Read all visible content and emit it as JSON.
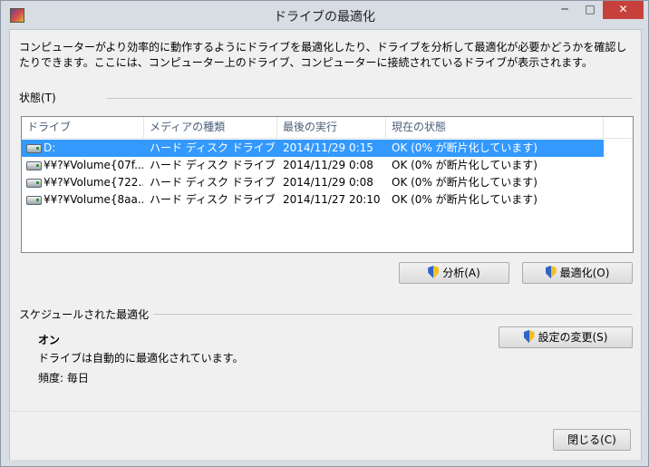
{
  "window": {
    "title": "ドライブの最適化",
    "minimize": "─",
    "maximize": "□",
    "close": "✕"
  },
  "description": "コンピューターがより効率的に動作するようにドライブを最適化したり、ドライブを分析して最適化が必要かどうかを確認したりできます。ここには、コンピューター上のドライブ、コンピューターに接続されているドライブが表示されます。",
  "status_section": {
    "label": "状態(T)",
    "columns": [
      "ドライブ",
      "メディアの種類",
      "最後の実行",
      "現在の状態"
    ],
    "rows": [
      {
        "drive": "D:",
        "media": "ハード ディスク ドライブ",
        "last_run": "2014/11/29 0:15",
        "status": "OK (0% が断片化しています)",
        "selected": true
      },
      {
        "drive": "¥¥?¥Volume{07f...",
        "media": "ハード ディスク ドライブ",
        "last_run": "2014/11/29 0:08",
        "status": "OK (0% が断片化しています)",
        "selected": false
      },
      {
        "drive": "¥¥?¥Volume{722...",
        "media": "ハード ディスク ドライブ",
        "last_run": "2014/11/29 0:08",
        "status": "OK (0% が断片化しています)",
        "selected": false
      },
      {
        "drive": "¥¥?¥Volume{8aa...",
        "media": "ハード ディスク ドライブ",
        "last_run": "2014/11/27 20:10",
        "status": "OK (0% が断片化しています)",
        "selected": false
      }
    ]
  },
  "buttons": {
    "analyze": "分析(A)",
    "optimize": "最適化(O)",
    "change_settings": "設定の変更(S)",
    "close": "閉じる(C)"
  },
  "schedule": {
    "label": "スケジュールされた最適化",
    "state": "オン",
    "detail": "ドライブは自動的に最適化されています。",
    "frequency": "頻度: 毎日"
  }
}
